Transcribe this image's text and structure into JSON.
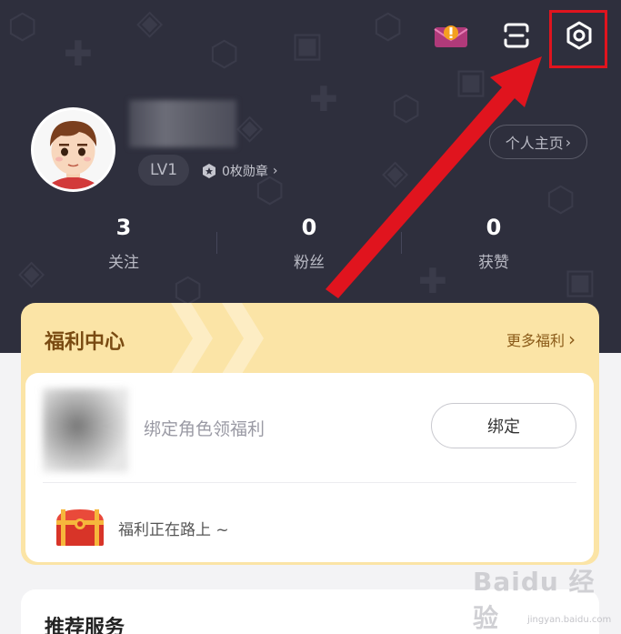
{
  "profile": {
    "level": "LV1",
    "medals": "0枚勋章",
    "homepage_link": "个人主页"
  },
  "stats": [
    {
      "value": "3",
      "label": "关注"
    },
    {
      "value": "0",
      "label": "粉丝"
    },
    {
      "value": "0",
      "label": "获赞"
    }
  ],
  "welfare": {
    "title": "福利中心",
    "more": "更多福利",
    "bind_text": "绑定角色领福利",
    "bind_button": "绑定",
    "on_the_way": "福利正在路上 ~"
  },
  "services": {
    "title": "推荐服务"
  },
  "watermark": {
    "brand": "Baidu 经验",
    "url": "jingyan.baidu.com"
  },
  "icons": {
    "envelope": "envelope-alert-icon",
    "scan": "scan-icon",
    "settings": "settings-gear-icon"
  },
  "colors": {
    "header_bg": "#2e2f3d",
    "welfare_bg": "#fbe4a6",
    "annotation_red": "#e0141e"
  }
}
